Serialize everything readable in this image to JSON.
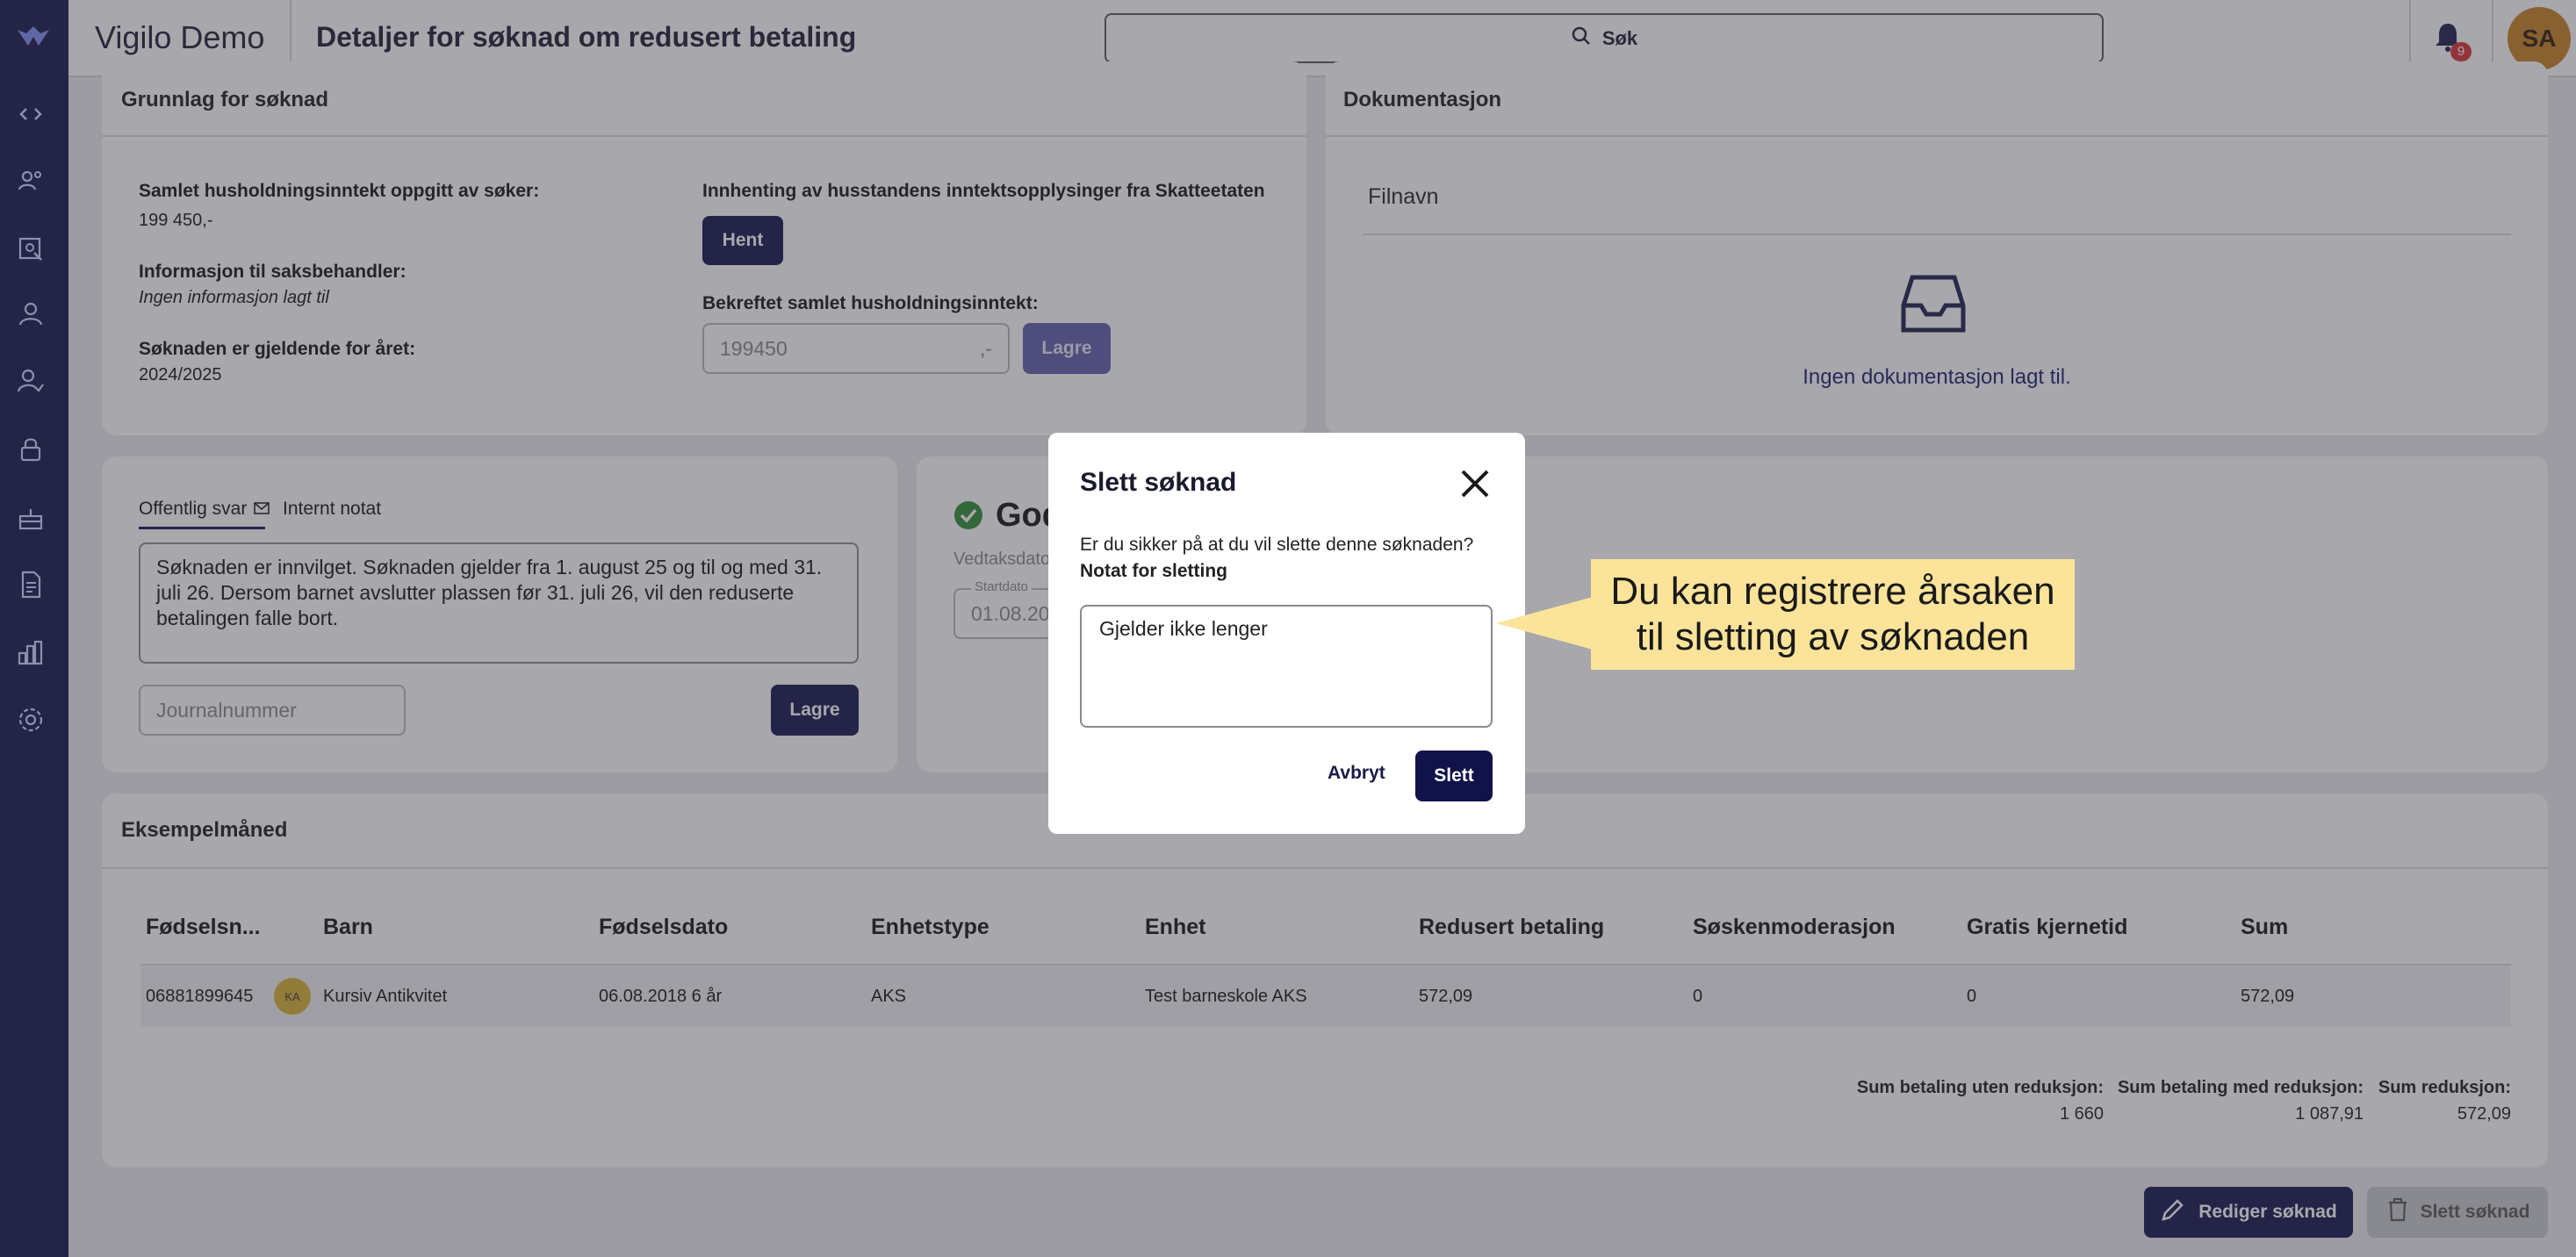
{
  "app": {
    "title": "Vigilo Demo",
    "page_title": "Detaljer for søknad om redusert betaling"
  },
  "search": {
    "label": "Søk"
  },
  "notifications": {
    "count": "9"
  },
  "user": {
    "initials": "SA"
  },
  "basis_card": {
    "title": "Grunnlag for søknad",
    "income_label": "Samlet husholdningsinntekt oppgitt av søker:",
    "income_value": "199 450,-",
    "info_label": "Informasjon til saksbehandler:",
    "info_value": "Ingen informasjon lagt til",
    "year_label": "Søknaden er gjeldende for året:",
    "year_value": "2024/2025",
    "fetch_label": "Innhenting av husstandens inntektsopplysinger fra Skatteetaten",
    "fetch_button": "Hent",
    "confirmed_label": "Bekreftet samlet husholdningsinntekt:",
    "confirmed_value": "199450",
    "confirmed_suffix": ",-",
    "save_button": "Lagre"
  },
  "doc_card": {
    "title": "Dokumentasjon",
    "column": "Filnavn",
    "empty": "Ingen dokumentasjon lagt til."
  },
  "reply_card": {
    "tab_public": "Offentlig svar",
    "tab_internal": "Internt notat",
    "reply_text": "Søknaden er innvilget. Søknaden gjelder fra 1. august 25 og til og med 31. juli 26. Dersom barnet avslutter plassen før 31. juli 26, vil den reduserte betalingen falle bort.",
    "journal_placeholder": "Journalnummer",
    "save_button": "Lagre"
  },
  "decision_card": {
    "status": "God",
    "decision_label": "Vedtaksdato",
    "start_label": "Startdato",
    "start_value": "01.08.20"
  },
  "example_card": {
    "title": "Eksempelmåned",
    "columns": [
      "Fødselsn...",
      "Barn",
      "Fødselsdato",
      "Enhetstype",
      "Enhet",
      "Redusert betaling",
      "Søskenmoderasjon",
      "Gratis kjernetid",
      "Sum"
    ],
    "row": {
      "ssn": "06881899645",
      "child_initials": "KA",
      "child": "Kursiv Antikvitet",
      "birth": "06.08.2018 6 år",
      "unit_type": "AKS",
      "unit": "Test barneskole AKS",
      "reduced": "572,09",
      "sibling": "0",
      "free": "0",
      "sum": "572,09"
    },
    "totals": [
      {
        "label": "Sum betaling uten reduksjon:",
        "value": "1 660"
      },
      {
        "label": "Sum betaling med reduksjon:",
        "value": "1 087,91"
      },
      {
        "label": "Sum reduksjon:",
        "value": "572,09"
      }
    ]
  },
  "actions": {
    "edit": "Rediger søknad",
    "delete": "Slett søknad"
  },
  "modal": {
    "title": "Slett søknad",
    "question": "Er du sikker på at du vil slette denne søknaden?",
    "note_label": "Notat for sletting",
    "note_value": "Gjelder ikke lenger",
    "cancel": "Avbryt",
    "confirm": "Slett"
  },
  "callout": {
    "text": "Du kan registrere årsaken til sletting av søknaden"
  }
}
